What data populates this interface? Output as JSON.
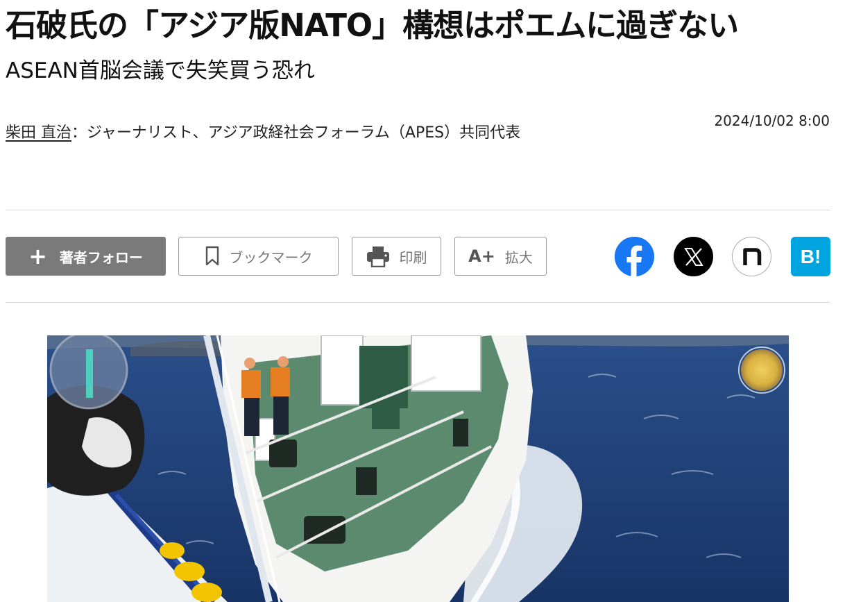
{
  "article": {
    "headline": "石破氏の「アジア版NATO」構想はポエムに過ぎない",
    "subheadline": "ASEAN首脳会議で失笑買う恐れ",
    "author_name": "柴田 直治",
    "author_role": "：ジャーナリスト、アジア政経社会フォーラム（APES）共同代表",
    "date": "2024/10/02 8:00"
  },
  "toolbar": {
    "follow_label": "著者フォロー",
    "bookmark_label": "ブックマーク",
    "print_label": "印刷",
    "zoom_icon_text": "A+",
    "zoom_label": "拡大"
  },
  "share": {
    "icons": [
      "facebook-icon",
      "x-icon",
      "note-icon",
      "hatena-bookmark-icon"
    ],
    "hatena_text": "B!"
  },
  "hero_image": {
    "depicts": "ship-collision-at-sea-photo"
  },
  "colors": {
    "follow_button": "#7a7a7a",
    "facebook": "#1877f2",
    "x": "#000000",
    "hatena": "#00a4de",
    "sea": "#1f3f78"
  }
}
